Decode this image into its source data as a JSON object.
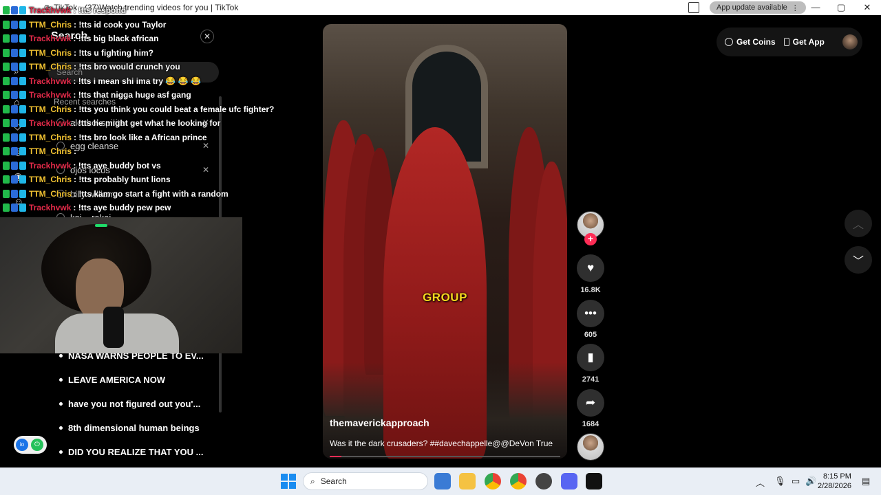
{
  "window": {
    "title": "TikTok - (37)Watch trending videos for you | TikTok",
    "update_label": "App update available",
    "update_menu": "⋮",
    "minimize": "—",
    "maximize": "▢",
    "close": "✕"
  },
  "search_panel": {
    "title": "Search",
    "close": "✕",
    "placeholder": "Search",
    "recent_label": "Recent searches",
    "recent": [
      "alcohol spirits",
      "egg cleanse",
      "ojos locos",
      "billy william",
      "koi... rakai"
    ],
    "suggestions": [
      "NASA WARNS PEOPLE TO EV...",
      "LEAVE AMERICA NOW",
      "have you not figured out you'...",
      "8th dimensional human beings",
      "DID YOU REALIZE THAT YOU ..."
    ]
  },
  "chat": [
    {
      "user": "Trackhvwk",
      "text": ": !tts respond",
      "color": "track"
    },
    {
      "user": "TTM_Chris",
      "text": ": !tts id cook you Taylor",
      "color": "chris"
    },
    {
      "user": "Trackhvwk",
      "text": ": !tts big black african",
      "color": "track"
    },
    {
      "user": "TTM_Chris",
      "text": ": !tts u fighting him?",
      "color": "chris"
    },
    {
      "user": "TTM_Chris",
      "text": ": !tts bro would crunch you",
      "color": "chris"
    },
    {
      "user": "Trackhvwk",
      "text": ": !tts i mean shi ima try 😂 😂 😂",
      "color": "track"
    },
    {
      "user": "Trackhvwk",
      "text": ": !tts that nigga huge asf gang",
      "color": "track"
    },
    {
      "user": "TTM_Chris",
      "text": ": !tts you think you could beat a female ufc fighter?",
      "color": "chris"
    },
    {
      "user": "Trackhvwk",
      "text": ": !tts he might get what he looking for",
      "color": "track"
    },
    {
      "user": "TTM_Chris",
      "text": ": !tts bro look like a African prince",
      "color": "chris"
    },
    {
      "user": "TTM_Chris",
      "text": ":",
      "color": "chris"
    },
    {
      "user": "Trackhvwk",
      "text": ": !tts aye buddy bot vs",
      "color": "track"
    },
    {
      "user": "TTM_Chris",
      "text": ": !tts probably hunt lions",
      "color": "chris"
    },
    {
      "user": "TTM_Chris",
      "text": ": !tts kam go start a fight with a random",
      "color": "chris"
    },
    {
      "user": "Trackhvwk",
      "text": ": !tts aye buddy pew pew",
      "color": "track"
    }
  ],
  "video": {
    "caption_word": "GROUP",
    "author": "themaverickapproach",
    "description": "Was it the dark crusaders? ##davechappelle@@DeVon True",
    "progress": 0.05
  },
  "actions": {
    "likes": "16.8K",
    "comments": "605",
    "saves": "2741",
    "shares": "1684",
    "follow": "+"
  },
  "top_right": {
    "coins": "Get Coins",
    "app": "Get App"
  },
  "taskbar": {
    "search": "Search",
    "time": "8:15 PM",
    "date": "2/28/2026"
  },
  "colors": {
    "accent": "#fe2c55",
    "chris": "#f1c232",
    "track": "#e52b4a",
    "caption": "#f5d91d"
  }
}
